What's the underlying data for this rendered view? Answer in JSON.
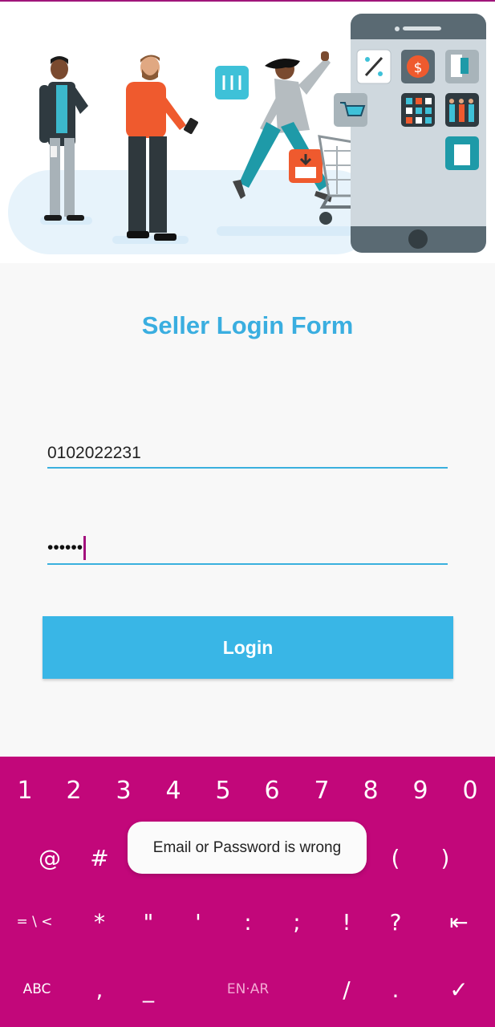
{
  "form": {
    "title": "Seller Login Form",
    "phone_value": "0102022231",
    "password_mask": "••••••",
    "login_label": "Login"
  },
  "toast": {
    "message": "Email or Password is wrong"
  },
  "keyboard": {
    "row1": [
      "1",
      "2",
      "3",
      "4",
      "5",
      "6",
      "7",
      "8",
      "9",
      "0"
    ],
    "row2": [
      "@",
      "#",
      "(",
      ")"
    ],
    "row3": [
      "= \\ <",
      "*",
      "\"",
      "'",
      ":",
      ";",
      "!",
      "?",
      "⇤"
    ],
    "row4": [
      "ABC",
      ",",
      "_",
      "EN·AR",
      "/",
      ".",
      "✓"
    ]
  },
  "colors": {
    "accent": "#39b6e6",
    "keyboard": "#c2077a",
    "title": "#3aaee0"
  }
}
